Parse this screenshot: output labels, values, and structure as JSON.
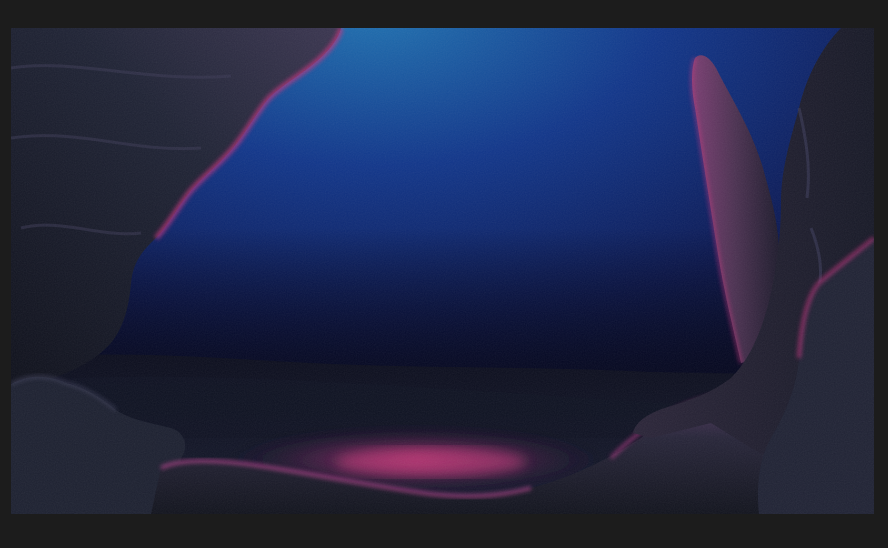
{
  "viewer": {
    "background_color": "#1c1c1c"
  },
  "image": {
    "subject_icon": "natural-image-cave-rocks",
    "colors": {
      "sky_top": "#1c6aa8",
      "sky_mid": "#0c2464",
      "sky_bottom": "#040722",
      "rock_dark": "#141826",
      "rock_mid": "#262c40",
      "rim_light": "#c4307e",
      "pool_glow": "#b3306f"
    }
  }
}
